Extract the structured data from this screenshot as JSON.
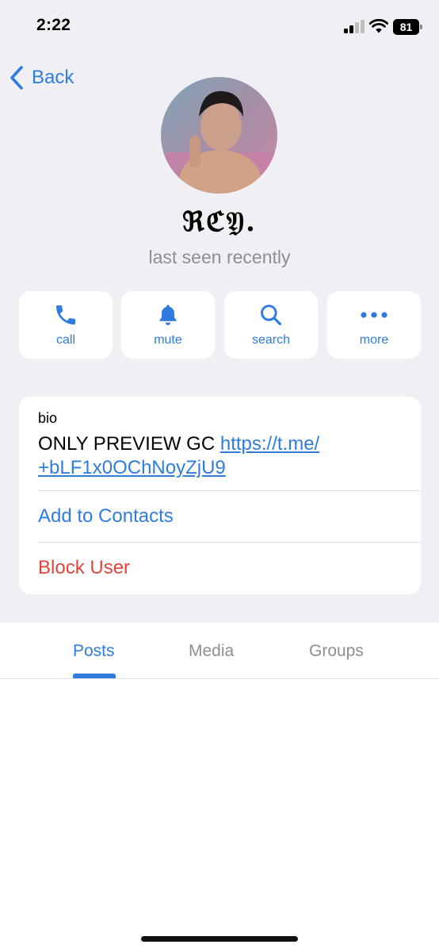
{
  "status_bar": {
    "time": "2:22",
    "battery": "81"
  },
  "nav": {
    "back_label": "Back"
  },
  "profile": {
    "name": "ℜℭ𝔜.",
    "status": "last seen recently"
  },
  "actions": [
    {
      "label": "call",
      "icon": "phone-icon"
    },
    {
      "label": "mute",
      "icon": "bell-icon"
    },
    {
      "label": "search",
      "icon": "search-icon"
    },
    {
      "label": "more",
      "icon": "ellipsis-icon"
    }
  ],
  "info": {
    "bio_label": "bio",
    "bio_text": "ONLY PREVIEW GC",
    "bio_link_line1": "https://t.me/",
    "bio_link_line2": "+bLF1x0OChNoyZjU9",
    "add_contact": "Add to Contacts",
    "block_user": "Block User"
  },
  "tabs": [
    {
      "label": "Posts",
      "active": true
    },
    {
      "label": "Media",
      "active": false
    },
    {
      "label": "Groups",
      "active": false
    }
  ],
  "colors": {
    "accent": "#2f7ce0",
    "destructive": "#e0453a",
    "secondary_text": "#8e8e93",
    "background": "#efeff4"
  }
}
